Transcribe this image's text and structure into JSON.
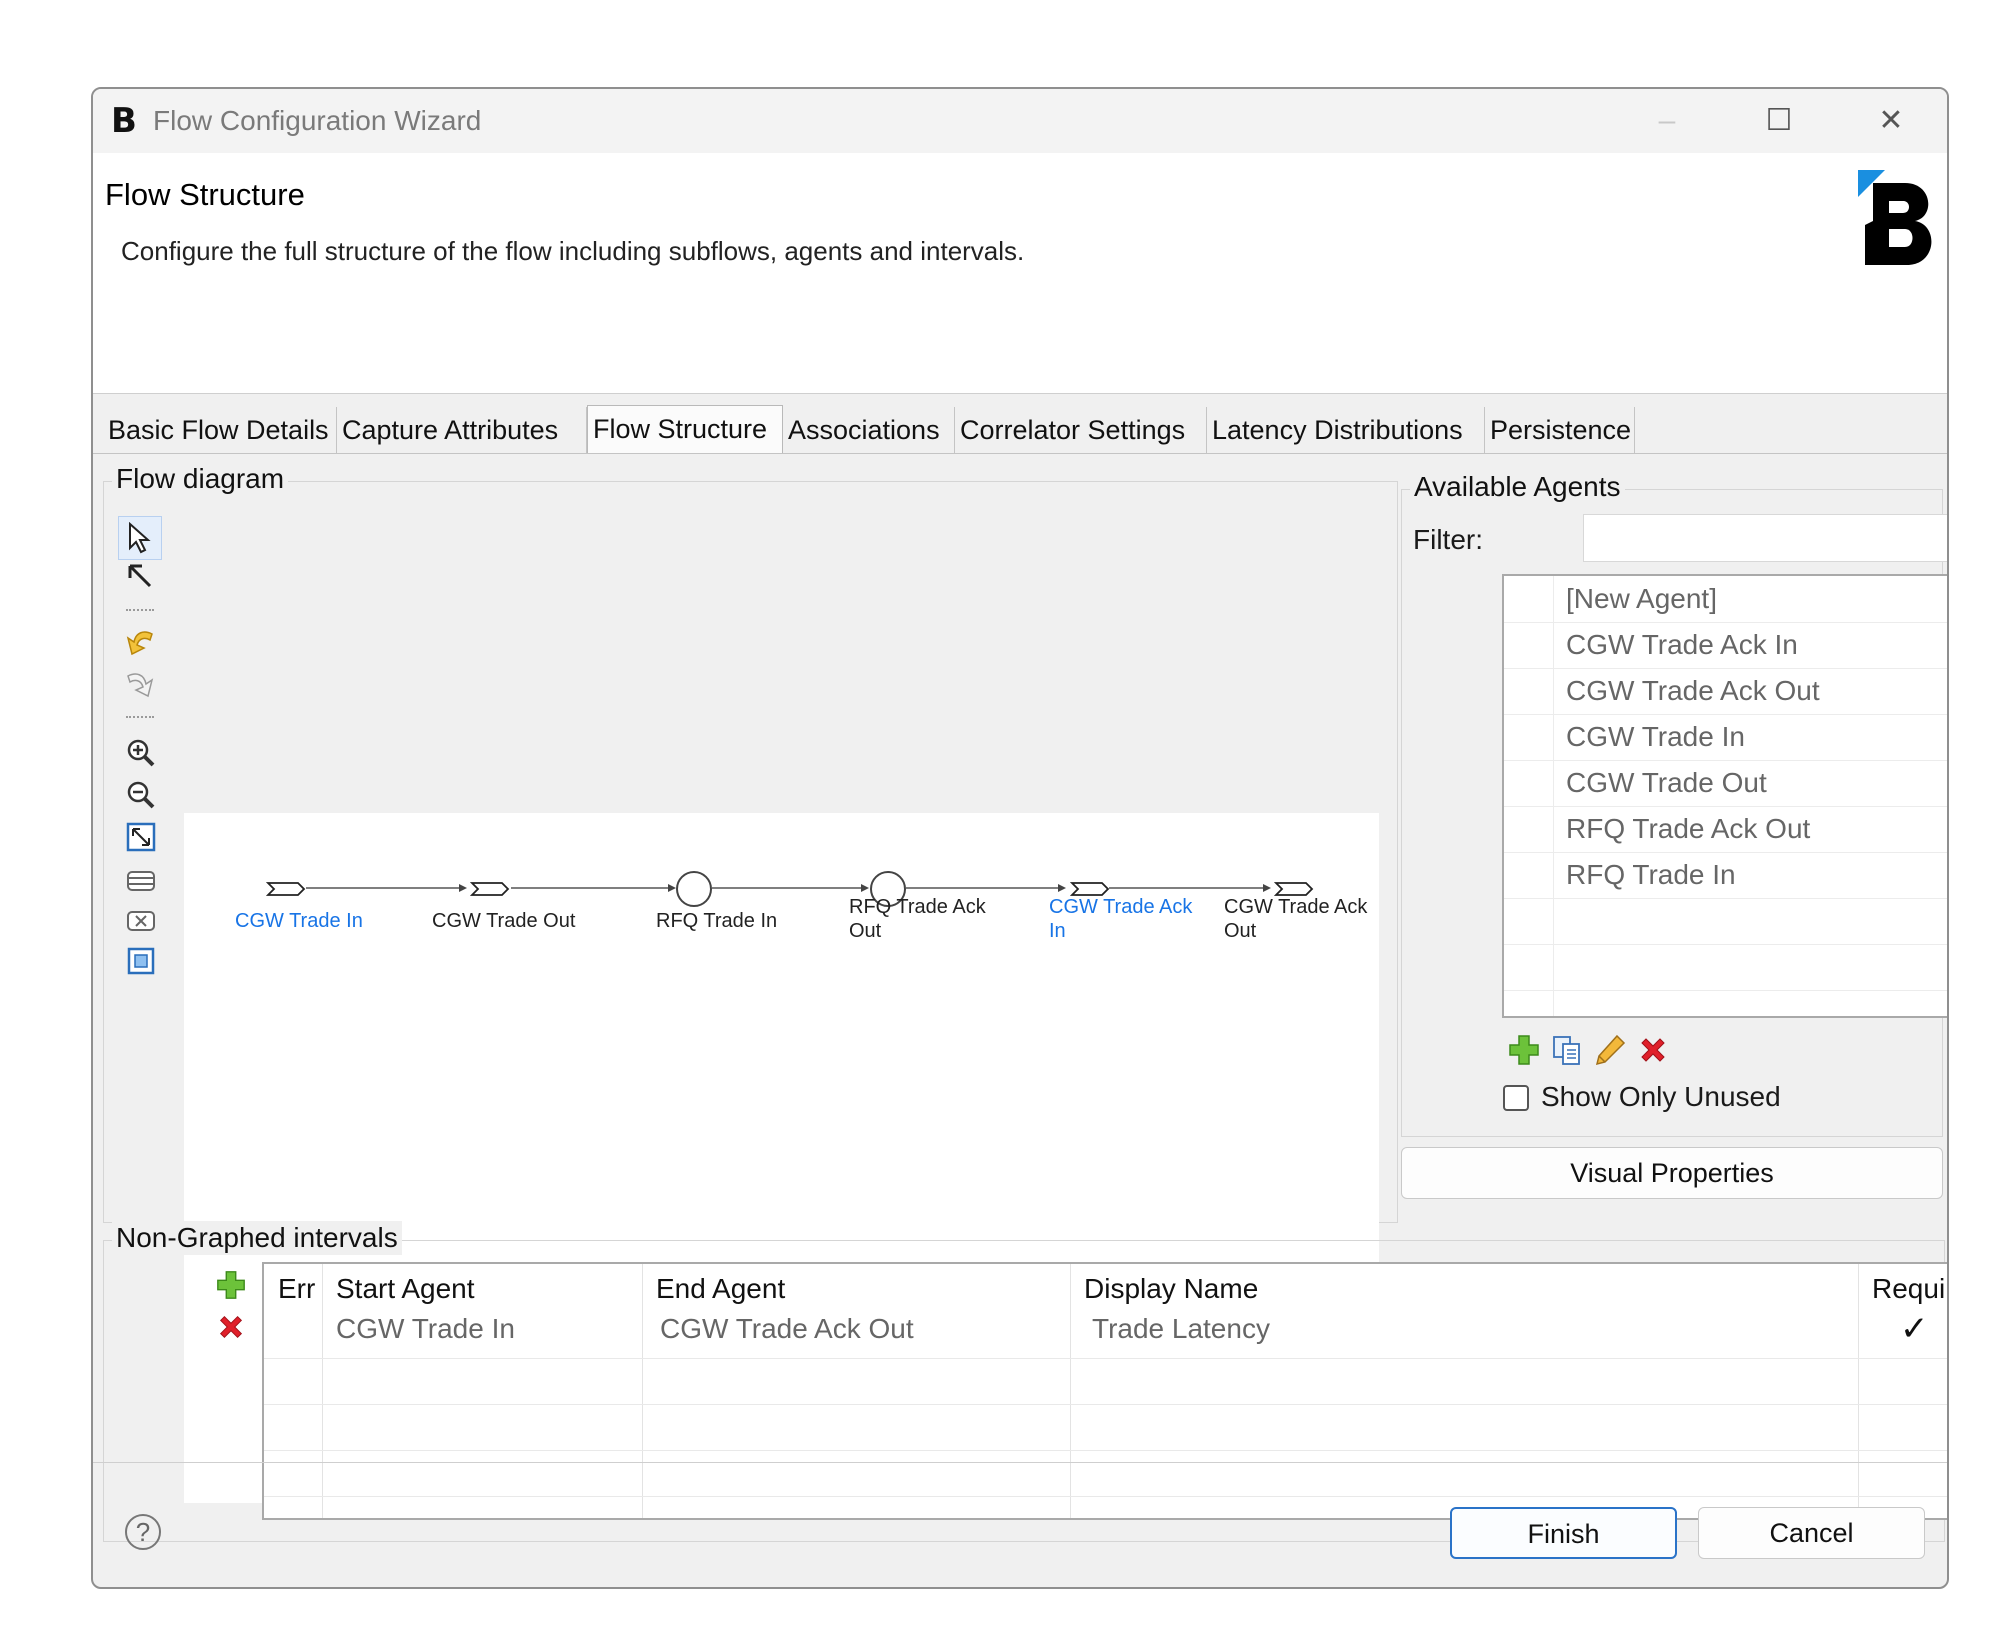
{
  "window": {
    "title": "Flow Configuration Wizard",
    "logo_letter": "B",
    "minimize": "–",
    "maximize": "☐",
    "close": "✕"
  },
  "header": {
    "title": "Flow Structure",
    "description": "Configure the full structure of the flow including subflows, agents and intervals."
  },
  "tabs": [
    {
      "label": "Basic Flow Details"
    },
    {
      "label": "Capture Attributes"
    },
    {
      "label": "Flow Structure",
      "active": true
    },
    {
      "label": "Associations"
    },
    {
      "label": "Correlator Settings"
    },
    {
      "label": "Latency Distributions"
    },
    {
      "label": "Persistence"
    }
  ],
  "flow_diagram": {
    "label": "Flow diagram",
    "nodes": [
      {
        "label": "CGW Trade In",
        "shape": "agent",
        "highlight": true
      },
      {
        "label": "CGW Trade Out",
        "shape": "agent",
        "highlight": false
      },
      {
        "label": "RFQ Trade In",
        "shape": "circle",
        "highlight": false
      },
      {
        "label": "RFQ Trade Ack\nOut",
        "shape": "circle",
        "highlight": false
      },
      {
        "label": "CGW Trade Ack\nIn",
        "shape": "agent",
        "highlight": true
      },
      {
        "label": "CGW Trade Ack\nOut",
        "shape": "agent",
        "highlight": false
      }
    ],
    "palette": [
      "select-icon",
      "connection-icon",
      "undo-icon",
      "redo-icon",
      "zoom-in-icon",
      "zoom-out-icon",
      "fit-icon",
      "expand-icon",
      "collapse-icon",
      "frame-icon"
    ]
  },
  "available_agents": {
    "label": "Available Agents",
    "filter_label": "Filter:",
    "filter_value": "",
    "items": [
      "[New Agent]",
      "CGW Trade Ack In",
      "CGW Trade Ack Out",
      "CGW Trade In",
      "CGW Trade Out",
      "RFQ Trade Ack Out",
      "RFQ Trade In"
    ],
    "show_only_unused_label": "Show Only Unused",
    "show_only_unused": false
  },
  "visual_properties_label": "Visual Properties",
  "intervals": {
    "label": "Non-Graphed intervals",
    "columns": {
      "err": "Err",
      "start": "Start Agent",
      "end": "End Agent",
      "display": "Display Name",
      "required": "Required"
    },
    "rows": [
      {
        "err": "",
        "start": "CGW Trade In",
        "end": "CGW Trade Ack Out",
        "display": "Trade Latency",
        "required": "✓"
      }
    ]
  },
  "footer": {
    "help": "?",
    "finish": "Finish",
    "cancel": "Cancel"
  },
  "colors": {
    "link_blue": "#1874e6",
    "add_green": "#5bb82e",
    "delete_red": "#e0202a"
  }
}
